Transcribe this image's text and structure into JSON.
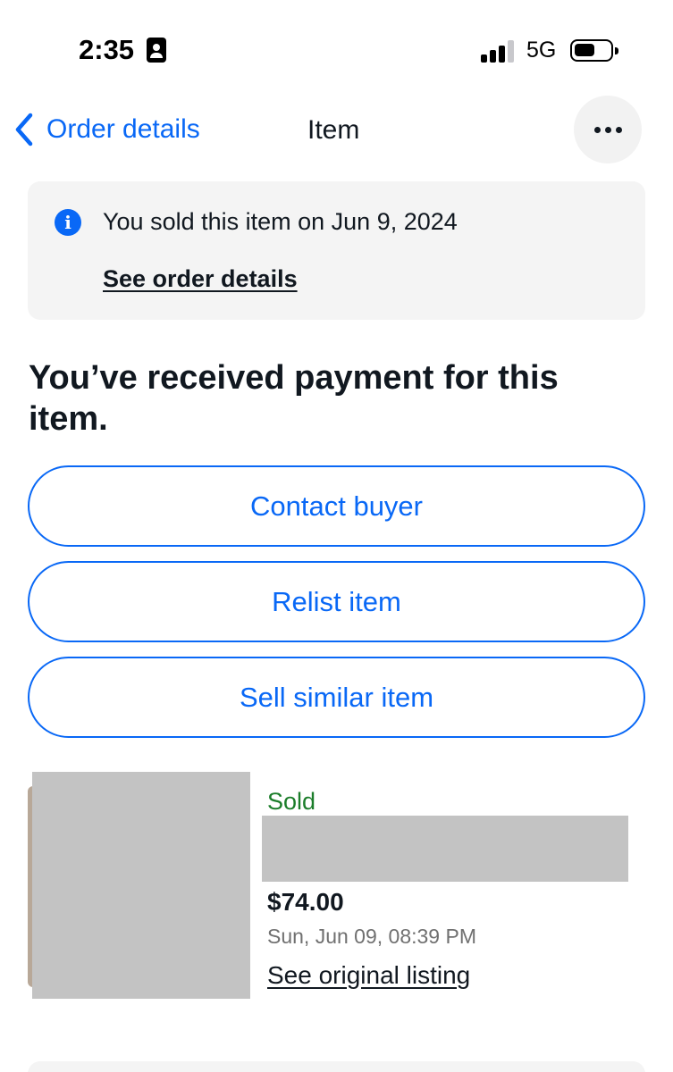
{
  "status_bar": {
    "time": "2:35",
    "network": "5G",
    "icons": [
      "contact-card-icon",
      "signal-icon",
      "battery-icon"
    ]
  },
  "nav": {
    "back_label": "Order details",
    "title": "Item",
    "more_icon": "more-horizontal-icon"
  },
  "banner": {
    "icon": "info-icon",
    "message": "You sold this item on Jun 9, 2024",
    "link": "See order details"
  },
  "heading": "You’ve received payment for this item.",
  "actions": {
    "contact_buyer": "Contact buyer",
    "relist_item": "Relist item",
    "sell_similar_item": "Sell similar item"
  },
  "item": {
    "status": "Sold",
    "price": "$74.00",
    "date": "Sun, Jun 09, 08:39 PM",
    "link": "See original listing"
  },
  "colors": {
    "accent": "#0968f6",
    "sold_green": "#1b7d2a",
    "banner_bg": "#f4f4f4",
    "redacted": "#c3c3c3"
  }
}
